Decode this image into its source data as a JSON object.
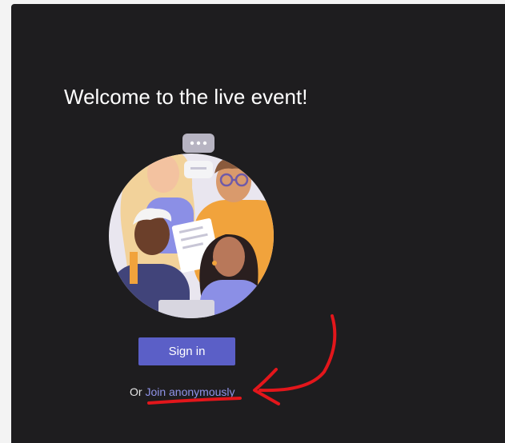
{
  "welcome": {
    "title": "Welcome to the live event!"
  },
  "illustration": {
    "icon": "people-group-illustration"
  },
  "actions": {
    "sign_in_label": "Sign in",
    "or_prefix": "Or",
    "join_anonymously_label": "Join anonymously"
  },
  "colors": {
    "background": "#1e1d1f",
    "accent": "#5b5fc7",
    "link": "#8f93e8",
    "annotation": "#e3161b"
  }
}
